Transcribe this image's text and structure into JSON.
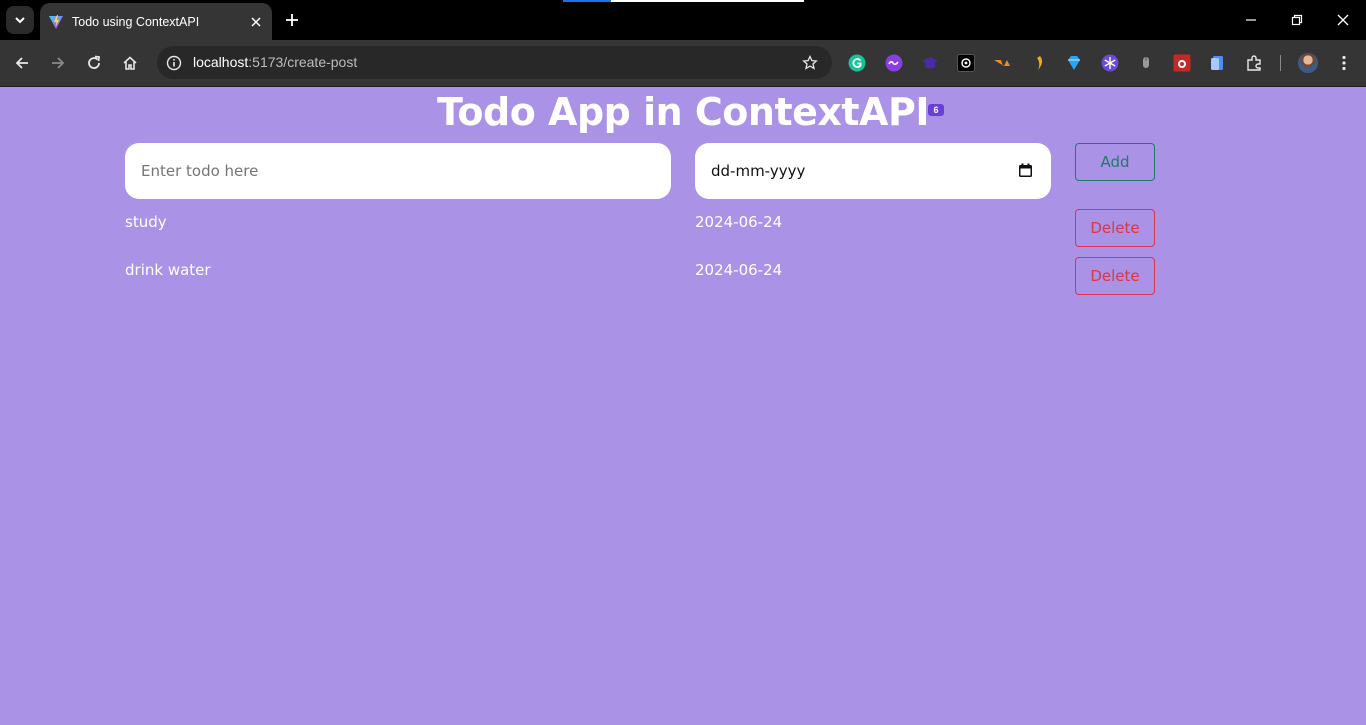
{
  "browser": {
    "tab_title": "Todo using ContextAPI",
    "url_host": "localhost",
    "url_path": ":5173/create-post",
    "extension_badge": "6"
  },
  "app": {
    "title": "Todo App in ContextAPI",
    "todo_placeholder": "Enter todo here",
    "date_placeholder": "dd-mm-yyyy",
    "add_label": "Add",
    "delete_label": "Delete"
  },
  "todos": [
    {
      "name": "study",
      "date": "2024-06-24"
    },
    {
      "name": "drink water",
      "date": "2024-06-24"
    }
  ],
  "colors": {
    "page_background": "#aa92e6",
    "add_button": "#1f7a6a",
    "delete_button": "#dc3545"
  }
}
